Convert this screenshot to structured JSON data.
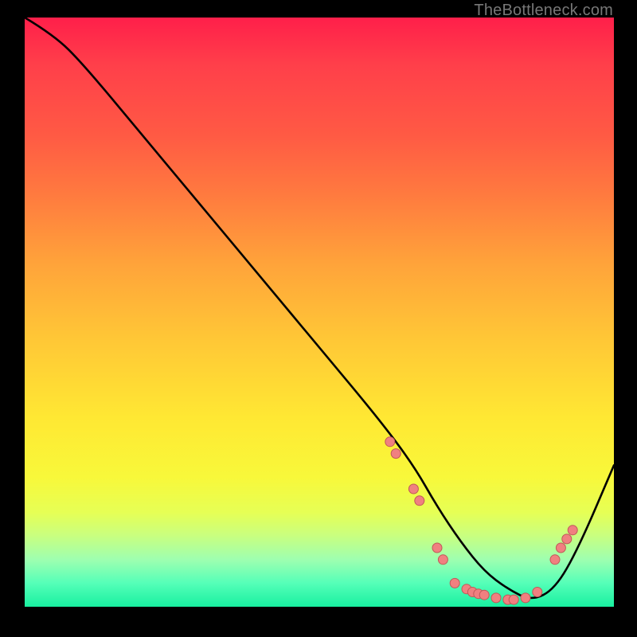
{
  "attribution": "TheBottleneck.com",
  "colors": {
    "stroke": "#000000",
    "dot_fill": "#f08080",
    "dot_stroke": "#c05858"
  },
  "chart_data": {
    "type": "line",
    "title": "",
    "xlabel": "",
    "ylabel": "",
    "xlim": [
      0,
      100
    ],
    "ylim": [
      0,
      100
    ],
    "series": [
      {
        "name": "curve",
        "x": [
          0,
          5,
          10,
          20,
          30,
          40,
          50,
          60,
          66,
          70,
          74,
          78,
          82,
          86,
          90,
          94,
          100
        ],
        "y": [
          100,
          97,
          92,
          80,
          68,
          56,
          44,
          32,
          24,
          17,
          11,
          6,
          3,
          1,
          3,
          10,
          24
        ]
      }
    ],
    "markers": [
      {
        "x": 62,
        "y": 28
      },
      {
        "x": 63,
        "y": 26
      },
      {
        "x": 66,
        "y": 20
      },
      {
        "x": 67,
        "y": 18
      },
      {
        "x": 70,
        "y": 10
      },
      {
        "x": 71,
        "y": 8
      },
      {
        "x": 73,
        "y": 4
      },
      {
        "x": 75,
        "y": 3
      },
      {
        "x": 76,
        "y": 2.5
      },
      {
        "x": 77,
        "y": 2.2
      },
      {
        "x": 78,
        "y": 2
      },
      {
        "x": 80,
        "y": 1.5
      },
      {
        "x": 82,
        "y": 1.2
      },
      {
        "x": 83,
        "y": 1.2
      },
      {
        "x": 85,
        "y": 1.5
      },
      {
        "x": 87,
        "y": 2.5
      },
      {
        "x": 90,
        "y": 8
      },
      {
        "x": 91,
        "y": 10
      },
      {
        "x": 92,
        "y": 11.5
      },
      {
        "x": 93,
        "y": 13
      }
    ]
  }
}
